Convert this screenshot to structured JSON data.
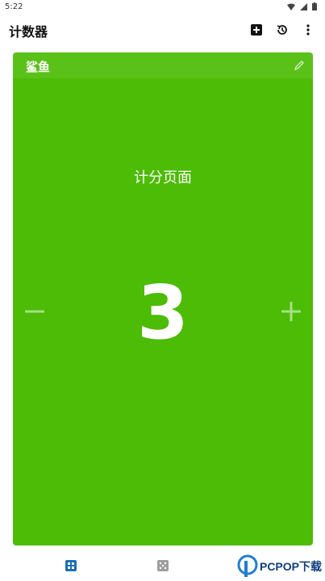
{
  "status_bar": {
    "time": "5:22"
  },
  "app_bar": {
    "title": "计数器"
  },
  "card": {
    "player_name": "鲨鱼",
    "page_label": "计分页面",
    "score": "3",
    "color": "#4cbc06"
  },
  "icons": {
    "add": "plus-square-icon",
    "history": "history-icon",
    "more": "more-vert-icon",
    "edit": "pencil-icon",
    "decrement": "minus-icon",
    "increment": "plus-icon"
  },
  "bottom_nav": {
    "items": [
      {
        "icon": "grid-icon",
        "active": true
      },
      {
        "icon": "dice-icon",
        "active": false
      }
    ],
    "active_color": "#1e6fb4",
    "inactive_color": "#9e9e9e"
  },
  "watermark": {
    "text": "PCPOP下载"
  }
}
